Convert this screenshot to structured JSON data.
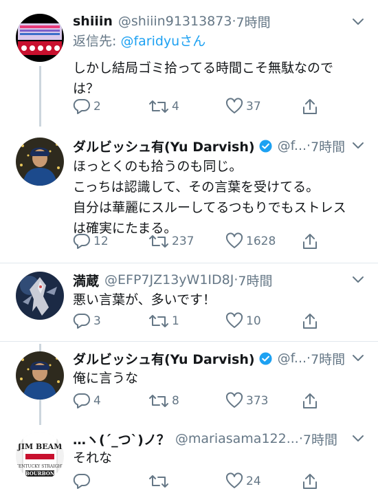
{
  "tweets": [
    {
      "name": "shiiin",
      "handle": "@shiiin91313873",
      "dot": "·",
      "time": "7時間",
      "verified": false,
      "reply_to_label": "返信先: ",
      "reply_to_user": "@faridyuさん",
      "lines": [
        "しかし結局ゴミ拾ってる時間こそ無駄なので",
        "は？"
      ],
      "replies": "2",
      "retweets": "4",
      "likes": "37"
    },
    {
      "name": "ダルビッシュ有(Yu Darvish)",
      "handle": "@f...",
      "dot": "·",
      "time": "7時間",
      "verified": true,
      "lines": [
        "ほっとくのも拾うのも同じ。",
        "こっちは認識して、その言葉を受けてる。",
        "自分は華麗にスルーしてるつもりでもストレス",
        "は確実にたまる。"
      ],
      "replies": "12",
      "retweets": "237",
      "likes": "1628"
    },
    {
      "name": "満蔵",
      "handle": "@EFP7JZ13yW1ID8J",
      "dot": "·",
      "time": "7時間",
      "verified": false,
      "lines": [
        "悪い言葉が、多いです！"
      ],
      "replies": "3",
      "retweets": "1",
      "likes": "10"
    },
    {
      "name": "ダルビッシュ有(Yu Darvish)",
      "handle": "@f...",
      "dot": "·",
      "time": "7時間",
      "verified": true,
      "lines": [
        "俺に言うな"
      ],
      "replies": "4",
      "retweets": "8",
      "likes": "373"
    },
    {
      "name": "…ヽ(´_つ`)ノ？",
      "handle": "@mariasama122...",
      "dot": "·",
      "time": "7時間",
      "verified": false,
      "lines": [
        "それな"
      ],
      "replies": "",
      "retweets": "",
      "likes": "24"
    }
  ],
  "colors": {
    "text": "#14171a",
    "secondary": "#657786",
    "link": "#1da1f2",
    "verified": "#1da1f2",
    "divider": "#e1e8ed",
    "thread_line": "#ccd6dd"
  }
}
